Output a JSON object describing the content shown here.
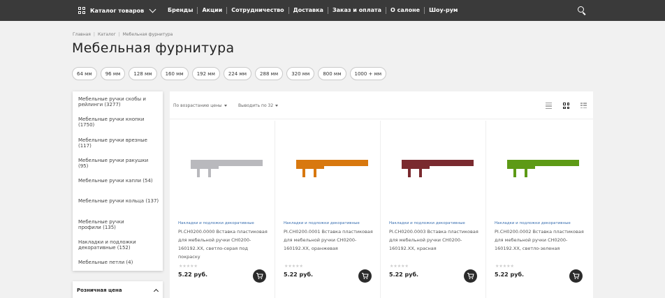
{
  "topbar": {
    "catalog_label": "Каталог товаров",
    "nav": [
      "Бренды",
      "Акции",
      "Сотрудничество",
      "Доставка",
      "Заказ и оплата",
      "О салоне",
      "Шоу-рум"
    ]
  },
  "breadcrumbs": [
    "Главная",
    "Каталог",
    "Мебельная фурнитура"
  ],
  "page_title": "Мебельная фурнитура",
  "sizes": [
    "64 мм",
    "96 мм",
    "128 мм",
    "160 мм",
    "192 мм",
    "224 мм",
    "288 мм",
    "320 мм",
    "800 мм",
    "1000 + мм"
  ],
  "sidebar": {
    "categories": [
      "Мебельные ручки скобы и рейлинги (3277)",
      "Мебельные ручки кнопки (1750)",
      "Мебельные ручки врезные (117)",
      "Мебельные ручки ракушки (95)",
      "Мебельные ручки капли (54)",
      "Мебельные ручки кольца (137)",
      "Мебельные ручки профили (135)",
      "Накладки и подложки декоративные (152)",
      "Мебельные петли (4)"
    ],
    "price_filter_label": "Розничная цена"
  },
  "toolbar": {
    "sort_label": "По возрастанию цены",
    "per_page_label": "Выводить по 32"
  },
  "products": [
    {
      "category": "Накладки и подложки декоративные",
      "name": "PI.CH0200.0000 Вставка пластиковая для мебельной ручки CH0200-160192.XX, светло-серая под покраску",
      "price": "5.22 руб.",
      "color": "#b9b9bd"
    },
    {
      "category": "Накладки и подложки декоративные",
      "name": "PI.CH0200.0001 Вставка пластиковая для мебельной ручки CH0200-160192.XX, оранжевая",
      "price": "5.22 руб.",
      "color": "#d8780f"
    },
    {
      "category": "Накладки и подложки декоративные",
      "name": "PI.CH0200.0003 Вставка пластиковая для мебельной ручки CH0200-160192.XX, красная",
      "price": "5.22 руб.",
      "color": "#7a2a2f"
    },
    {
      "category": "Накладки и подложки декоративные",
      "name": "PI.CH0200.0002 Вставка пластиковая для мебельной ручки CH0200-160192.XX, светло-зеленая",
      "price": "5.22 руб.",
      "color": "#5d9a16"
    }
  ],
  "stars_glyph": "★★★★★"
}
